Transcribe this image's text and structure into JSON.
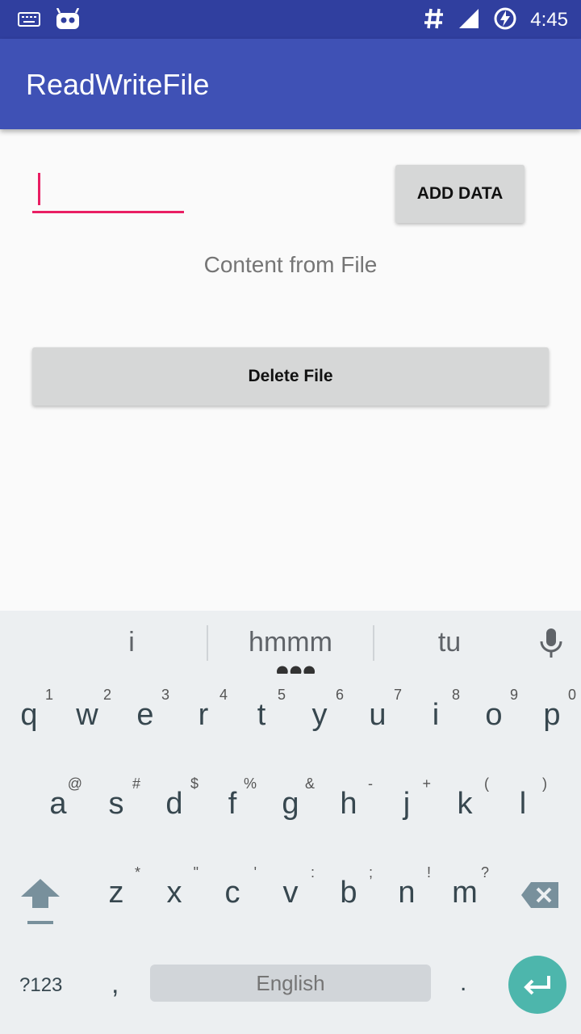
{
  "status_bar": {
    "time": "4:45",
    "icons": [
      "keyboard-icon",
      "android-icon",
      "hash-icon",
      "signal-icon",
      "battery-charging-icon"
    ]
  },
  "app_bar": {
    "title": "ReadWriteFile"
  },
  "main": {
    "input_value": "",
    "add_button_label": "ADD DATA",
    "content_label": "Content from File",
    "delete_button_label": "Delete File"
  },
  "keyboard": {
    "suggestions": [
      "i",
      "hmmm",
      "tu"
    ],
    "row1": [
      {
        "key": "q",
        "hint": "1"
      },
      {
        "key": "w",
        "hint": "2"
      },
      {
        "key": "e",
        "hint": "3"
      },
      {
        "key": "r",
        "hint": "4"
      },
      {
        "key": "t",
        "hint": "5"
      },
      {
        "key": "y",
        "hint": "6"
      },
      {
        "key": "u",
        "hint": "7"
      },
      {
        "key": "i",
        "hint": "8"
      },
      {
        "key": "o",
        "hint": "9"
      },
      {
        "key": "p",
        "hint": "0"
      }
    ],
    "row2": [
      {
        "key": "a",
        "hint": "@"
      },
      {
        "key": "s",
        "hint": "#"
      },
      {
        "key": "d",
        "hint": "$"
      },
      {
        "key": "f",
        "hint": "%"
      },
      {
        "key": "g",
        "hint": "&"
      },
      {
        "key": "h",
        "hint": "-"
      },
      {
        "key": "j",
        "hint": "+"
      },
      {
        "key": "k",
        "hint": "("
      },
      {
        "key": "l",
        "hint": ")"
      }
    ],
    "row3": [
      {
        "key": "z",
        "hint": "*"
      },
      {
        "key": "x",
        "hint": "\""
      },
      {
        "key": "c",
        "hint": "'"
      },
      {
        "key": "v",
        "hint": ":"
      },
      {
        "key": "b",
        "hint": ";"
      },
      {
        "key": "n",
        "hint": "!"
      },
      {
        "key": "m",
        "hint": "?"
      }
    ],
    "symbols_label": "?123",
    "comma_label": ",",
    "space_label": "English",
    "period_label": "."
  }
}
